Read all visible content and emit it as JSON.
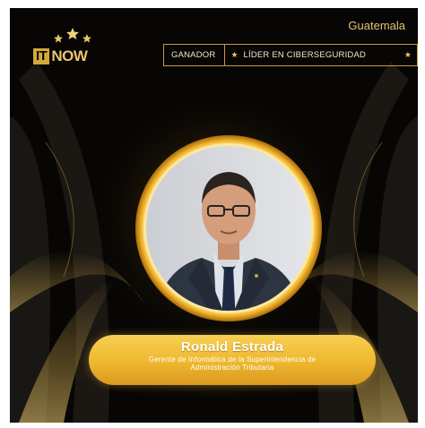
{
  "brand": {
    "logo_part1": "IT",
    "logo_part2": "NOW",
    "stars_icon": "three-stars-icon"
  },
  "header": {
    "country": "Guatemala",
    "award_category": "GANADOR",
    "award_title": "LÍDER EN CIBERSEGURIDAD",
    "star_glyph": "★"
  },
  "winner": {
    "name": "Ronald Estrada",
    "role": "Gerente de Informática de la Superintendencia de Administración Tributaria"
  },
  "colors": {
    "background": "#070605",
    "gold": "#d4a83a",
    "pill": "#eeb72f",
    "text_light": "#f3e6c5"
  }
}
